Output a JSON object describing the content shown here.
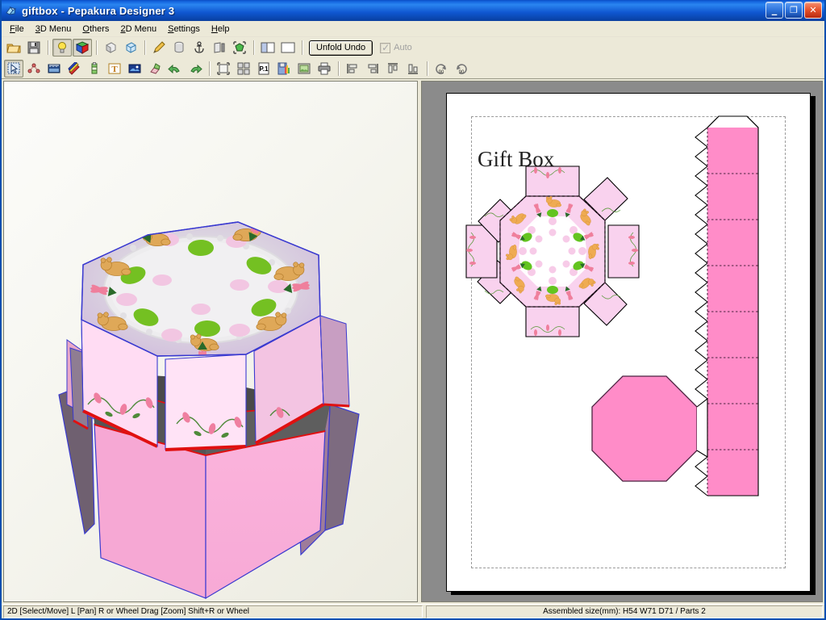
{
  "window": {
    "title": "giftbox - Pepakura Designer 3",
    "app_icon": "pepakura-icon",
    "buttons": {
      "minimize": "minimize-button",
      "maximize": "maximize-button",
      "close": "close-button",
      "minimize_glyph": "_",
      "maximize_glyph": "❐",
      "close_glyph": "✕"
    }
  },
  "menu": [
    {
      "label": "File",
      "accel": "F"
    },
    {
      "label": "3D Menu",
      "accel": "3"
    },
    {
      "label": "Others",
      "accel": "O"
    },
    {
      "label": "2D Menu",
      "accel": "2"
    },
    {
      "label": "Settings",
      "accel": "S"
    },
    {
      "label": "Help",
      "accel": "H"
    }
  ],
  "toolbar_top": {
    "unfold_undo_label": "Unfold Undo",
    "auto_label": "Auto",
    "auto_checked": true,
    "auto_enabled": false,
    "items": [
      {
        "name": "open-file-icon",
        "type": "icon"
      },
      {
        "name": "save-file-icon",
        "type": "icon"
      },
      {
        "sep": true
      },
      {
        "name": "light-bulb-icon",
        "type": "icon",
        "pressed": true
      },
      {
        "name": "texture-cube-icon",
        "type": "icon",
        "pressed": true
      },
      {
        "sep": true
      },
      {
        "name": "flat-shading-icon",
        "type": "icon"
      },
      {
        "name": "wireframe-icon",
        "type": "icon"
      },
      {
        "sep": true
      },
      {
        "name": "pencil-edit-icon",
        "type": "icon"
      },
      {
        "name": "cylinder-icon",
        "type": "icon"
      },
      {
        "name": "anchor-icon",
        "type": "icon"
      },
      {
        "name": "face-split-icon",
        "type": "icon"
      },
      {
        "name": "select-mesh-icon",
        "type": "icon"
      },
      {
        "sep": true
      },
      {
        "name": "split-view-vertical-icon",
        "type": "icon"
      },
      {
        "name": "single-view-icon",
        "type": "icon"
      },
      {
        "sep": true
      }
    ]
  },
  "toolbar_bottom": {
    "items": [
      {
        "name": "select-move-cursor-icon",
        "type": "icon",
        "pressed": true
      },
      {
        "name": "edge-connect-icon",
        "type": "icon"
      },
      {
        "name": "ruler-measure-icon",
        "type": "icon"
      },
      {
        "name": "paint-stripes-icon",
        "type": "icon"
      },
      {
        "name": "glue-tab-icon",
        "type": "icon"
      },
      {
        "name": "text-tool-icon",
        "type": "icon"
      },
      {
        "name": "image-insert-icon",
        "type": "icon"
      },
      {
        "name": "open-flap-icon",
        "type": "icon"
      },
      {
        "name": "undo-icon",
        "type": "icon"
      },
      {
        "name": "redo-icon",
        "type": "icon"
      },
      {
        "sep": true
      },
      {
        "name": "bounding-box-icon",
        "type": "icon"
      },
      {
        "name": "layout-parts-icon",
        "type": "icon"
      },
      {
        "name": "page-setup-icon",
        "type": "icon"
      },
      {
        "name": "save-texture-icon",
        "type": "icon"
      },
      {
        "name": "picture-export-icon",
        "type": "icon"
      },
      {
        "name": "print-icon",
        "type": "icon"
      },
      {
        "sep": true
      },
      {
        "name": "align-left-icon",
        "type": "icon"
      },
      {
        "name": "align-right-icon",
        "type": "icon"
      },
      {
        "name": "align-top-icon",
        "type": "icon"
      },
      {
        "name": "align-bottom-icon",
        "type": "icon"
      },
      {
        "sep": true
      },
      {
        "name": "rotate-ccw-90-icon",
        "type": "icon",
        "label": "90"
      },
      {
        "name": "rotate-cw-90-icon",
        "type": "icon",
        "label": "90"
      }
    ]
  },
  "panel_3d": {
    "name": "3d-model-view",
    "model": "octagonal gift box with lid, pink with teddy bear and floral pattern"
  },
  "panel_2d": {
    "name": "2d-unfold-view",
    "page_title": "Gift Box",
    "parts": [
      {
        "name": "lid-unfold-part",
        "description": "octagonal lid with eight side flaps, patterned"
      },
      {
        "name": "box-side-strip-part",
        "description": "vertical strip of eight box side panels with tabs"
      },
      {
        "name": "box-bottom-octagon-part",
        "description": "plain pink octagon base"
      }
    ]
  },
  "statusbar": {
    "left": "2D [Select/Move] L [Pan] R or Wheel Drag [Zoom] Shift+R or Wheel",
    "right": "Assembled size(mm): H54 W71 D71 / Parts 2"
  },
  "colors": {
    "titlebar_blue": "#0a4cc4",
    "chrome": "#ece9d8",
    "panel_2d_bg": "#8b8b8b",
    "pink_fill": "#ff8cc8",
    "pink_light": "#f9c9e8",
    "lid_pink": "#ffd9f0",
    "lid_lilac": "#d7c0df",
    "cut_line": "#000000",
    "fold_line": "#4b2340",
    "edge_red": "#e01010",
    "edge_blue": "#3a3ad0"
  }
}
